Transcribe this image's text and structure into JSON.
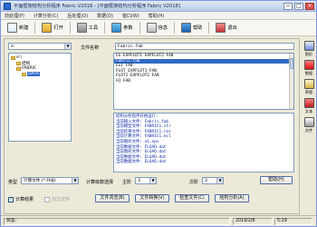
{
  "window": {
    "title": "平面框架结构分析程序 Fabric V2018 - [平面框架结构分析程序 Fabric V2018]",
    "minimize": "−",
    "maximize": "□",
    "close": "×"
  },
  "menubar": {
    "items": [
      "前处理(P)",
      "计算分析(C)",
      "后处理(O)",
      "数据(D)",
      "窗口(W)",
      "帮助(H)"
    ]
  },
  "toolbar": {
    "new_label": "新建",
    "open_label": "打开",
    "tools_label": "工具",
    "params_label": "参数",
    "info_label": "信息",
    "help_label": "帮助",
    "exit_label": "退出"
  },
  "drive": {
    "value": "e:",
    "arrow": "▼"
  },
  "tree": {
    "items": [
      {
        "label": "e:\\",
        "level": 0,
        "selected": false
      },
      {
        "label": "结构",
        "level": 1,
        "selected": false
      },
      {
        "label": "FABRIC",
        "level": 1,
        "selected": false
      },
      {
        "label": "DATA",
        "level": 2,
        "selected": true
      }
    ]
  },
  "filename": {
    "label": "文件名称",
    "value": "Fabric.fab"
  },
  "filelist": {
    "items": [
      {
        "name": "CG EXPFLOT1 EXPFLOT2 FAB",
        "selected": false
      },
      {
        "name": "Fabric.fab",
        "selected": true
      },
      {
        "name": "Ex1 FAB",
        "selected": false
      },
      {
        "name": "FLOT EXPFLOT1 FAB",
        "selected": false
      },
      {
        "name": "FLOT2 EXPFLOT2 FAB",
        "selected": false
      },
      {
        "name": "HJ FAB",
        "selected": false
      }
    ]
  },
  "log": {
    "lines": [
      "结构分析程序开始运行:",
      "当前输入文件: Fabric.fab",
      "当前模型文件: FABRIC1.str",
      "当前结果文件: FABRIC1.res",
      "当前计算文件: FABRIC1.ecl",
      "当前图形文件: a1.eps",
      "当前数据文件: FLOAD.dat",
      "当前图形文件: ELOAD.dat",
      "当前数据文件: ELOAD.dat",
      "当前数据文件: ELOAD.dat"
    ]
  },
  "options": {
    "type_label": "类型",
    "type_value": "计算文件 (*.FAB)",
    "arrow": "▼",
    "analysis_label": "计算级数选择",
    "main_label": "主阶",
    "main_value": "3",
    "sub_label": "次阶",
    "sub_value": "3",
    "help_button": "帮助(H)"
  },
  "actions": {
    "calc_result_label": "计算结果",
    "calc_result_checked": "✓",
    "internal_label": "内力文件",
    "browse_button": "文件浏览(B)",
    "convert_button": "文件转换(V)",
    "check_button": "检查文件(C)",
    "analyze_button": "结构分析(A)"
  },
  "sidebar": {
    "graph_label": "图形",
    "data_label": "数据",
    "sketch_label": "草图",
    "text_label": "文本",
    "file_label": "文件"
  },
  "status": {
    "state": "状态:",
    "date": "2019/2/6",
    "time": "5:29"
  }
}
